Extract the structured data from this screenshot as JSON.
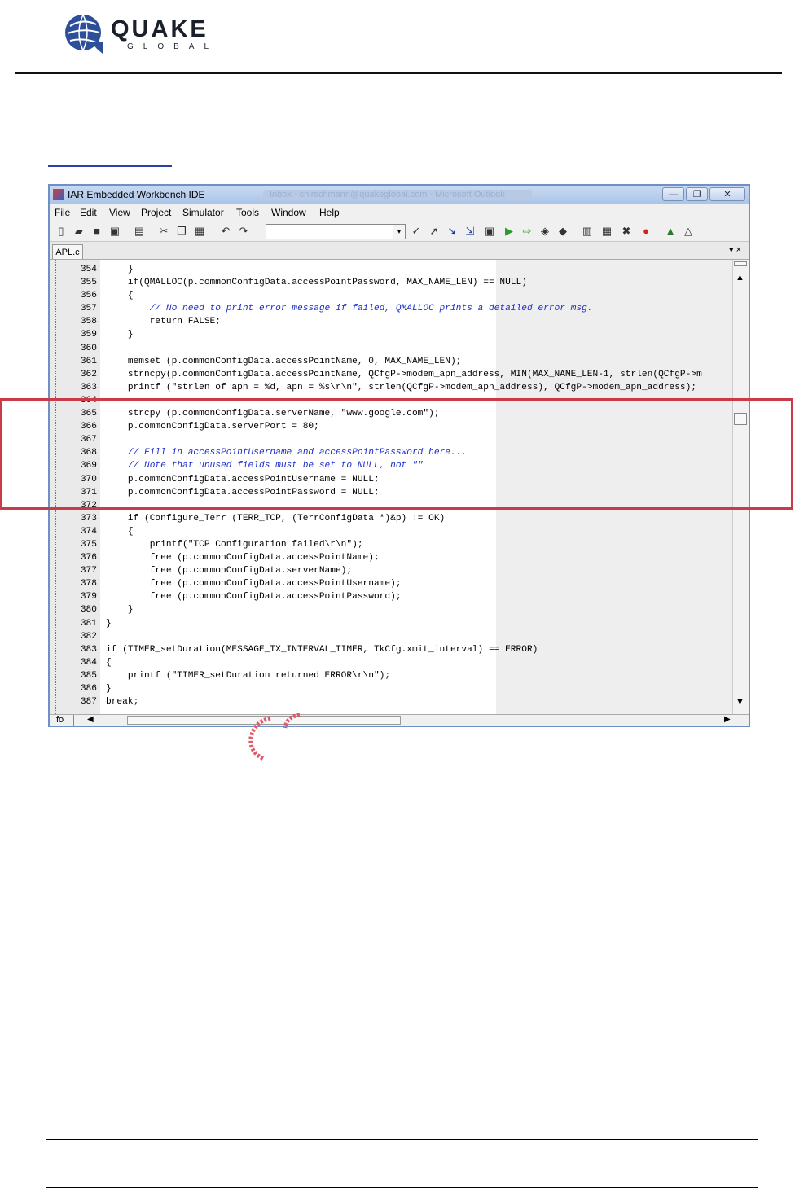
{
  "brand": {
    "name": "QUAKE",
    "sub": "GLOBAL"
  },
  "ide": {
    "title": "IAR Embedded Workbench IDE",
    "title_extra": "Inbox - chirschmann@quakeglobal.com - Microsoft Outlook",
    "window_buttons": {
      "minimize": "—",
      "maximize": "❐",
      "close": "✕"
    },
    "menu": [
      "File",
      "Edit",
      "View",
      "Project",
      "Simulator",
      "Tools",
      "Window",
      "Help"
    ],
    "tab_label": "APL.c",
    "tab_controls": "▾ ×",
    "status_field": "fo",
    "scroll_left": "◀",
    "scroll_right": "▶",
    "scroll_up": "▲",
    "scroll_down": "▼",
    "combo_arrow": "▾",
    "toolbar_icons": [
      "new-file-icon",
      "open-folder-icon",
      "save-icon",
      "save-all-icon",
      "print-icon",
      "cut-icon",
      "copy-icon",
      "paste-icon",
      "undo-icon",
      "redo-icon",
      "find-icon",
      "find-next-icon",
      "goto-icon",
      "bookmark-icon",
      "toggle-bookmark-icon",
      "next-bookmark-icon",
      "prev-bookmark-icon",
      "compile-icon",
      "make-icon",
      "stop-build-icon",
      "breakpoint-icon",
      "debug-icon",
      "debug-no-download-icon"
    ]
  },
  "code_lines": [
    {
      "n": "354",
      "t": "    }",
      "c": false
    },
    {
      "n": "355",
      "t": "    if(QMALLOC(p.commonConfigData.accessPointPassword, MAX_NAME_LEN) == NULL)",
      "c": false
    },
    {
      "n": "356",
      "t": "    {",
      "c": false
    },
    {
      "n": "357",
      "t": "        // No need to print error message if failed, QMALLOC prints a detailed error msg.",
      "c": true
    },
    {
      "n": "358",
      "t": "        return FALSE;",
      "c": false
    },
    {
      "n": "359",
      "t": "    }",
      "c": false
    },
    {
      "n": "360",
      "t": "",
      "c": false
    },
    {
      "n": "361",
      "t": "    memset (p.commonConfigData.accessPointName, 0, MAX_NAME_LEN);",
      "c": false
    },
    {
      "n": "362",
      "t": "    strncpy(p.commonConfigData.accessPointName, QCfgP->modem_apn_address, MIN(MAX_NAME_LEN-1, strlen(QCfgP->m",
      "c": false
    },
    {
      "n": "363",
      "t": "    printf (\"strlen of apn = %d, apn = %s\\r\\n\", strlen(QCfgP->modem_apn_address), QCfgP->modem_apn_address);",
      "c": false
    },
    {
      "n": "364",
      "t": "",
      "c": false
    },
    {
      "n": "365",
      "t": "    strcpy (p.commonConfigData.serverName, \"www.google.com\");",
      "c": false
    },
    {
      "n": "366",
      "t": "    p.commonConfigData.serverPort = 80;",
      "c": false
    },
    {
      "n": "367",
      "t": "",
      "c": false
    },
    {
      "n": "368",
      "t": "    // Fill in accessPointUsername and accessPointPassword here...",
      "c": true
    },
    {
      "n": "369",
      "t": "    // Note that unused fields must be set to NULL, not \"\"",
      "c": true
    },
    {
      "n": "370",
      "t": "    p.commonConfigData.accessPointUsername = NULL;",
      "c": false
    },
    {
      "n": "371",
      "t": "    p.commonConfigData.accessPointPassword = NULL;",
      "c": false
    },
    {
      "n": "372",
      "t": "",
      "c": false
    },
    {
      "n": "373",
      "t": "    if (Configure_Terr (TERR_TCP, (TerrConfigData *)&p) != OK)",
      "c": false
    },
    {
      "n": "374",
      "t": "    {",
      "c": false
    },
    {
      "n": "375",
      "t": "        printf(\"TCP Configuration failed\\r\\n\");",
      "c": false
    },
    {
      "n": "376",
      "t": "        free (p.commonConfigData.accessPointName);",
      "c": false
    },
    {
      "n": "377",
      "t": "        free (p.commonConfigData.serverName);",
      "c": false
    },
    {
      "n": "378",
      "t": "        free (p.commonConfigData.accessPointUsername);",
      "c": false
    },
    {
      "n": "379",
      "t": "        free (p.commonConfigData.accessPointPassword);",
      "c": false
    },
    {
      "n": "380",
      "t": "    }",
      "c": false
    },
    {
      "n": "381",
      "t": "}",
      "c": false
    },
    {
      "n": "382",
      "t": "",
      "c": false
    },
    {
      "n": "383",
      "t": "if (TIMER_setDuration(MESSAGE_TX_INTERVAL_TIMER, TkCfg.xmit_interval) == ERROR)",
      "c": false
    },
    {
      "n": "384",
      "t": "{",
      "c": false
    },
    {
      "n": "385",
      "t": "    printf (\"TIMER_setDuration returned ERROR\\r\\n\");",
      "c": false
    },
    {
      "n": "386",
      "t": "}",
      "c": false
    },
    {
      "n": "387",
      "t": "break;",
      "c": false
    }
  ],
  "colors": {
    "highlight_box": "#c83c4a",
    "comment": "#1e2fc8",
    "window_border": "#6f8fc7"
  }
}
